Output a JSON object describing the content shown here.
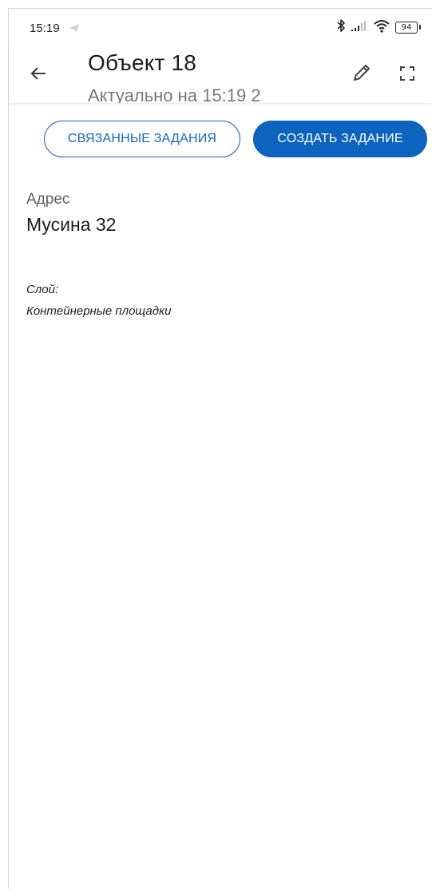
{
  "status_bar": {
    "time": "15:19",
    "battery": "94",
    "icons": [
      "telegram-icon",
      "bluetooth-icon",
      "signal-icon",
      "wifi-icon",
      "battery-icon"
    ]
  },
  "header": {
    "title": "Объект 18",
    "subtitle": "Актуально на 15:19 2",
    "icons": [
      "back-arrow-icon",
      "edit-pencil-icon",
      "fullscreen-icon"
    ]
  },
  "actions": {
    "related_tasks": "СВЯЗАННЫЕ ЗАДАНИЯ",
    "create_task": "СОЗДАТЬ ЗАДАНИЕ"
  },
  "details": {
    "address_label": "Адрес",
    "address_value": "Мусина 32",
    "layer_label": "Слой:",
    "layer_value": "Контейнерные площадки"
  },
  "colors": {
    "accent": "#0d64be",
    "text_primary": "#1c1c1c",
    "text_secondary": "#5f5f5f"
  }
}
